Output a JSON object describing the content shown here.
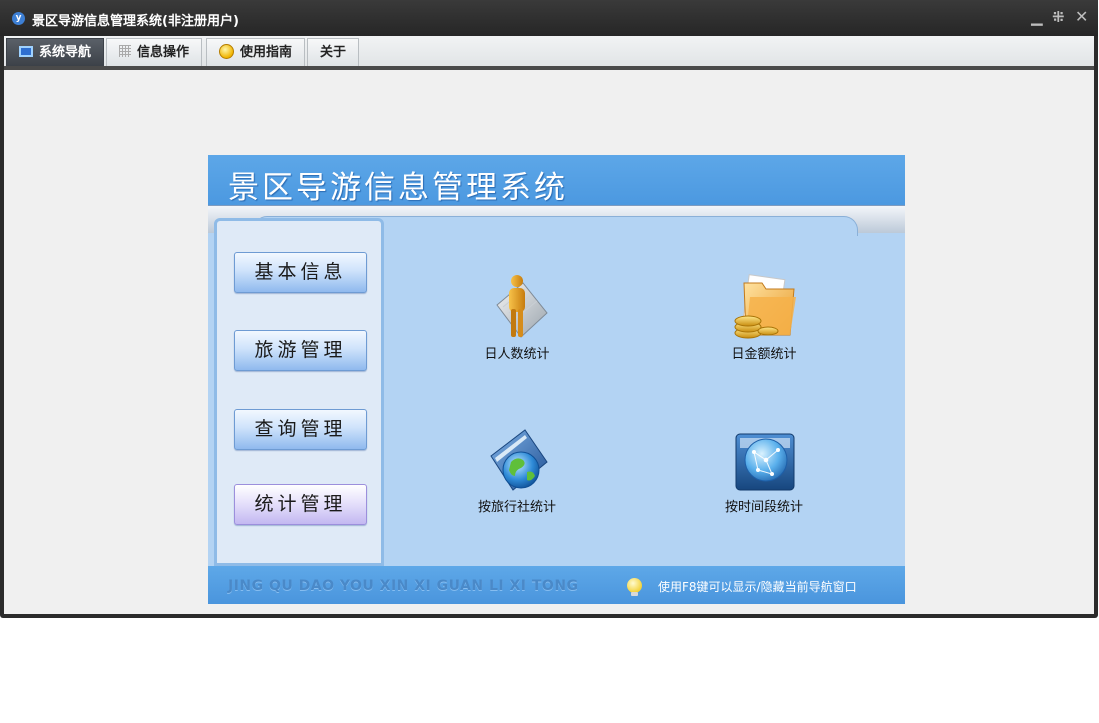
{
  "window": {
    "title": "景区导游信息管理系统(非注册用户)",
    "logo_glyph": "y"
  },
  "menubar": {
    "tabs": [
      {
        "label": "系统导航",
        "icon": "monitor-icon",
        "active": true
      },
      {
        "label": "信息操作",
        "icon": "grid-icon",
        "active": false
      },
      {
        "label": "使用指南",
        "icon": "guide-icon",
        "active": false
      },
      {
        "label": "关于",
        "icon": "",
        "active": false
      }
    ]
  },
  "panel": {
    "title": "景区导游信息管理系统",
    "sidebar": [
      {
        "label": "基本信息",
        "active": false
      },
      {
        "label": "旅游管理",
        "active": false
      },
      {
        "label": "查询管理",
        "active": false
      },
      {
        "label": "统计管理",
        "active": true
      }
    ],
    "tiles": [
      {
        "label": "日人数统计",
        "icon": "person-stats-icon"
      },
      {
        "label": "日金额统计",
        "icon": "folder-coins-icon"
      },
      {
        "label": "按旅行社统计",
        "icon": "globe-book-icon"
      },
      {
        "label": "按时间段统计",
        "icon": "network-globe-icon"
      }
    ],
    "footer": {
      "pinyin": "JING QU DAO YOU XIN XI GUAN LI XI TONG",
      "tip": "使用F8键可以显示/隐藏当前导航窗口"
    }
  },
  "colors": {
    "header_blue": "#4b98e0",
    "panel_bg": "#b3d3f3",
    "title_bar": "#2b2b2b"
  }
}
